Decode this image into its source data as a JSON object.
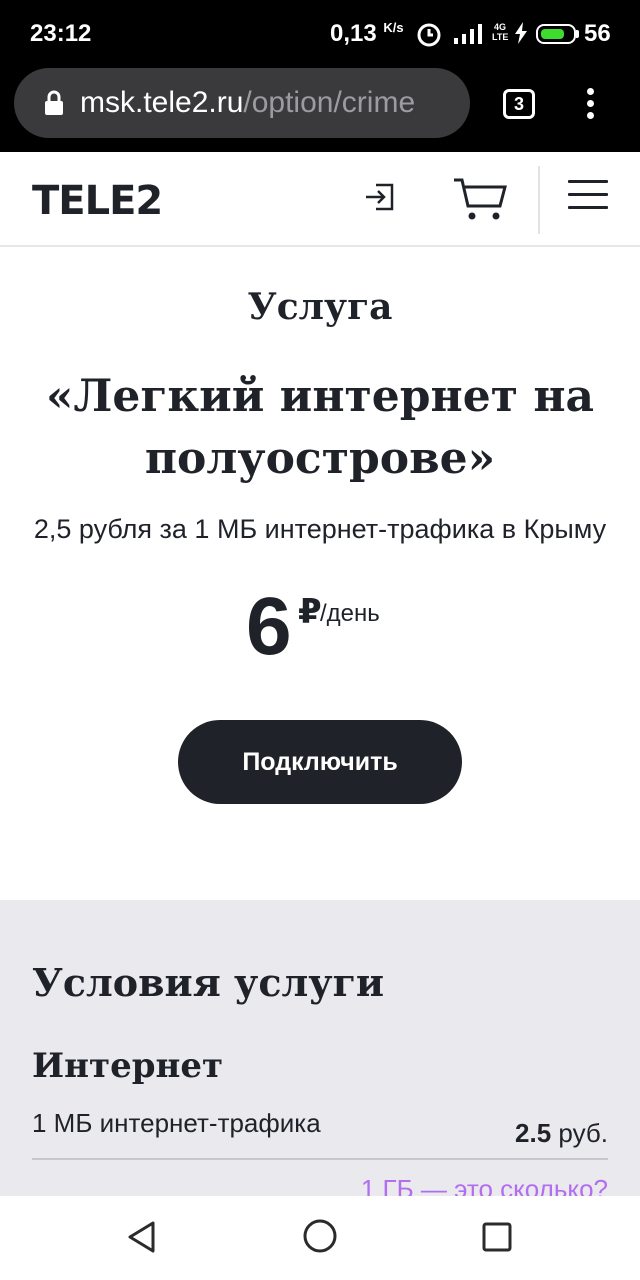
{
  "status_bar": {
    "time": "23:12",
    "speed": "0,13",
    "speed_unit": "K/s",
    "network": "4G\nLTE",
    "battery_level": "56",
    "battery_fill_fraction": 0.75,
    "battery_color": "#3ddc2f"
  },
  "browser": {
    "url_host": "msk.tele2.ru",
    "url_path": "/option/crime",
    "tab_count": "3"
  },
  "header": {
    "logo": "TELE2"
  },
  "hero": {
    "label": "Услуга",
    "title": "«Легкий интернет на полуостровe»",
    "description": "2,5 рубля за 1 МБ интернет-трафика в Крыму",
    "price": "6",
    "currency": "₽",
    "period": "/день",
    "button": "Подключить"
  },
  "conditions": {
    "title": "Условия услуги",
    "section": "Интернет",
    "row_label": "1 МБ интернет-трафика",
    "row_value": "2.5",
    "row_unit": "руб.",
    "link": "1 ГБ — это сколько?",
    "link_color": "#b36ef0"
  },
  "colors": {
    "dark": "#1f2229",
    "gray_bg": "#e9e9ee"
  }
}
